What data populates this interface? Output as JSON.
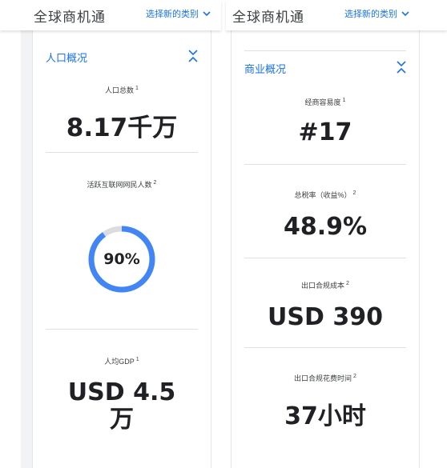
{
  "left": {
    "app_title": "全球商机通",
    "category_link": "选择新的类别",
    "section_title": "人口概况",
    "stats": [
      {
        "label": "人口总数",
        "note": "1",
        "value": "8.17千万"
      },
      {
        "label": "活跃互联网网民人数",
        "note": "2",
        "value": "90%",
        "progress": 0.9
      },
      {
        "label": "人均GDP",
        "note": "1",
        "value_line1": "USD 4.5",
        "value_line2": "万"
      }
    ]
  },
  "right": {
    "app_title": "全球商机通",
    "category_link": "选择新的类别",
    "section_title": "商业概况",
    "stats": [
      {
        "label": "经商容易度",
        "note": "1",
        "value": "#17"
      },
      {
        "label": "总税率（收益%）",
        "note": "2",
        "value": "48.9%"
      },
      {
        "label": "出口合规成本",
        "note": "2",
        "value": "USD 390"
      },
      {
        "label": "出口合规花费时间",
        "note": "2",
        "value": "37小时"
      }
    ]
  },
  "colors": {
    "accent": "#1a73e8",
    "ring_fill": "#4285f4",
    "ring_track": "#dadce0"
  },
  "icons": {
    "dropdown": "chevron-down-icon",
    "collapse": "unfold-less-icon"
  }
}
